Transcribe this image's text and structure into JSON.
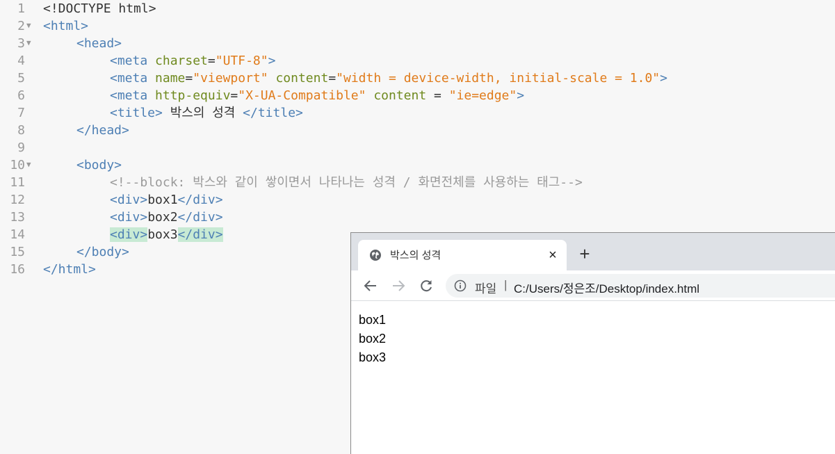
{
  "editor": {
    "lines": [
      {
        "n": "1",
        "fold": false,
        "indent": 0,
        "tokens": [
          {
            "t": "doc",
            "v": "<!DOCTYPE html>"
          }
        ]
      },
      {
        "n": "2",
        "fold": true,
        "indent": 0,
        "tokens": [
          {
            "t": "tag",
            "v": "<html>"
          }
        ]
      },
      {
        "n": "3",
        "fold": true,
        "indent": 1,
        "tokens": [
          {
            "t": "tag",
            "v": "<head>"
          }
        ]
      },
      {
        "n": "4",
        "fold": false,
        "indent": 2,
        "tokens": [
          {
            "t": "tag",
            "v": "<meta "
          },
          {
            "t": "attr",
            "v": "charset"
          },
          {
            "t": "txt",
            "v": "="
          },
          {
            "t": "str",
            "v": "\"UTF-8\""
          },
          {
            "t": "tag",
            "v": ">"
          }
        ]
      },
      {
        "n": "5",
        "fold": false,
        "indent": 2,
        "tokens": [
          {
            "t": "tag",
            "v": "<meta "
          },
          {
            "t": "attr",
            "v": "name"
          },
          {
            "t": "txt",
            "v": "="
          },
          {
            "t": "str",
            "v": "\"viewport\""
          },
          {
            "t": "txt",
            "v": " "
          },
          {
            "t": "attr",
            "v": "content"
          },
          {
            "t": "txt",
            "v": "="
          },
          {
            "t": "str",
            "v": "\"width = device-width, initial-scale = 1.0\""
          },
          {
            "t": "tag",
            "v": ">"
          }
        ]
      },
      {
        "n": "6",
        "fold": false,
        "indent": 2,
        "tokens": [
          {
            "t": "tag",
            "v": "<meta "
          },
          {
            "t": "attr",
            "v": "http-equiv"
          },
          {
            "t": "txt",
            "v": "="
          },
          {
            "t": "str",
            "v": "\"X-UA-Compatible\""
          },
          {
            "t": "txt",
            "v": " "
          },
          {
            "t": "attr",
            "v": "content"
          },
          {
            "t": "txt",
            "v": " = "
          },
          {
            "t": "str",
            "v": "\"ie=edge\""
          },
          {
            "t": "tag",
            "v": ">"
          }
        ]
      },
      {
        "n": "7",
        "fold": false,
        "indent": 2,
        "tokens": [
          {
            "t": "tag",
            "v": "<title>"
          },
          {
            "t": "txt",
            "v": " 박스의 성격 "
          },
          {
            "t": "tag",
            "v": "</title>"
          }
        ]
      },
      {
        "n": "8",
        "fold": false,
        "indent": 1,
        "tokens": [
          {
            "t": "tag",
            "v": "</head>"
          }
        ]
      },
      {
        "n": "9",
        "fold": false,
        "indent": 0,
        "tokens": []
      },
      {
        "n": "10",
        "fold": true,
        "indent": 1,
        "tokens": [
          {
            "t": "tag",
            "v": "<body>"
          }
        ]
      },
      {
        "n": "11",
        "fold": false,
        "indent": 2,
        "tokens": [
          {
            "t": "cmt",
            "v": "<!--block: 박스와 같이 쌓이면서 나타나는 성격 / 화면전체를 사용하는 태그-->"
          }
        ]
      },
      {
        "n": "12",
        "fold": false,
        "indent": 2,
        "tokens": [
          {
            "t": "tag",
            "v": "<div>"
          },
          {
            "t": "txt",
            "v": "box1"
          },
          {
            "t": "tag",
            "v": "</div>"
          }
        ]
      },
      {
        "n": "13",
        "fold": false,
        "indent": 2,
        "tokens": [
          {
            "t": "tag",
            "v": "<div>"
          },
          {
            "t": "txt",
            "v": "box2"
          },
          {
            "t": "tag",
            "v": "</div>"
          }
        ]
      },
      {
        "n": "14",
        "fold": false,
        "indent": 2,
        "tokens": [
          {
            "t": "tag",
            "v": "<div>",
            "hl": true
          },
          {
            "t": "txt",
            "v": "box3"
          },
          {
            "t": "tag",
            "v": "</div>",
            "hl": true
          }
        ]
      },
      {
        "n": "15",
        "fold": false,
        "indent": 1,
        "tokens": [
          {
            "t": "tag",
            "v": "</body>"
          }
        ]
      },
      {
        "n": "16",
        "fold": false,
        "indent": 0,
        "tokens": [
          {
            "t": "tag",
            "v": "</html>"
          }
        ]
      }
    ],
    "fold_marker": "▼"
  },
  "browser": {
    "tab_title": "박스의 성격",
    "tab_close": "×",
    "new_tab": "+",
    "url_scheme": "파일",
    "url_separator": "|",
    "url": "C:/Users/정은조/Desktop/index.html",
    "page_lines": [
      "box1",
      "box2",
      "box3"
    ]
  }
}
